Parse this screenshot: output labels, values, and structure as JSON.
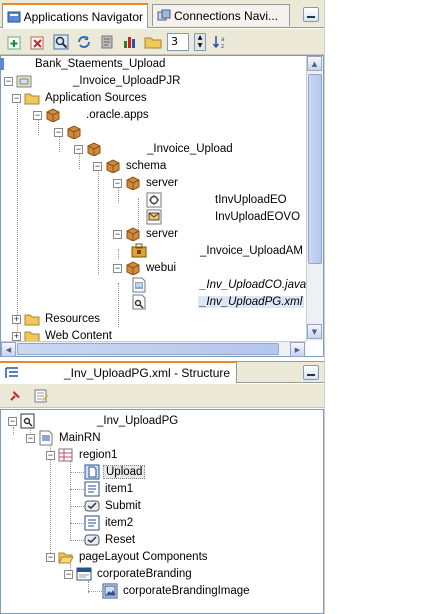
{
  "tabs": {
    "applications_navigator": "Applications Navigator",
    "connections_navigator": "Connections Navi..."
  },
  "toolbar": {
    "level_value": "3",
    "icons": [
      "add-icon",
      "remove-icon",
      "find-icon",
      "refresh-icon",
      "properties-icon",
      "chart-icon",
      "folder-icon"
    ]
  },
  "navigator_tree": {
    "workspace": "Bank_Staements_Upload",
    "project": "_Invoice_UploadPJR",
    "app_sources": "Application Sources",
    "pkg_oracle_apps": ".oracle.apps",
    "pkg_invoice_upload": "_Invoice_Upload",
    "schema": "schema",
    "schema_server": "server",
    "eo": "tInvUploadEO",
    "eovo": "InvUploadEOVO",
    "server": "server",
    "am": "_Invoice_UploadAM",
    "webui": "webui",
    "co": "_Inv_UploadCO.java",
    "pg": "_Inv_UploadPG.xml",
    "resources": "Resources",
    "web_content": "Web Content"
  },
  "structure": {
    "title": "_Inv_UploadPG.xml - Structure",
    "root": "_Inv_UploadPG",
    "mainrn": "MainRN",
    "region1": "region1",
    "upload": "Upload",
    "item1": "item1",
    "submit": "Submit",
    "item2": "item2",
    "reset": "Reset",
    "plc": "pageLayout Components",
    "corp_branding": "corporateBranding",
    "corp_branding_image": "corporateBrandingImage"
  },
  "colors": {
    "accent_tab": "#e68b2c",
    "chrome": "#ece9d8",
    "border": "#7f9db9",
    "folder": "#f1c75b",
    "package": "#d08a3a"
  }
}
